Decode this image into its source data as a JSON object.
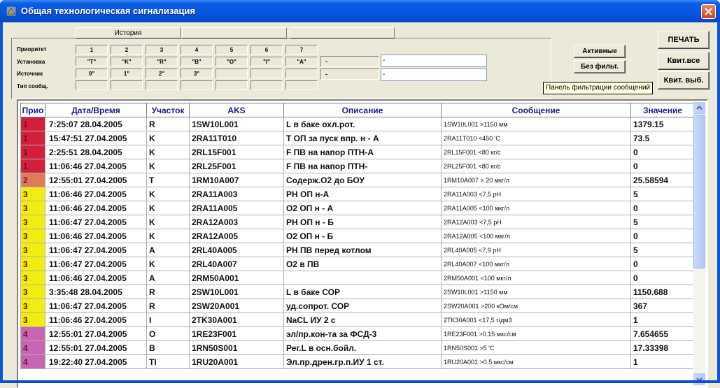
{
  "window": {
    "title": "Общая технологическая сигнализация"
  },
  "header_tabs": [
    "История",
    "",
    ""
  ],
  "filter": {
    "labels": {
      "priority": "Приоритет",
      "setting": "Установка",
      "source": "Источник",
      "msg_type": "Тип сообщ."
    },
    "priority_cols": [
      "1",
      "2",
      "3",
      "4",
      "5",
      "6",
      "7"
    ],
    "setting_vals": [
      "\"T\"",
      "\"K\"",
      "\"R\"",
      "\"B\"",
      "\"O\"",
      "\"I\"",
      "\"A\""
    ],
    "source_vals": [
      "0\"",
      "1\"",
      "2\"",
      "3\"",
      "",
      "",
      ""
    ],
    "dash_1": "-",
    "dash_2": "-",
    "field_1": "-",
    "field_2": "-"
  },
  "buttons": {
    "active": "Активные",
    "no_filter": "Без фильт.",
    "print": "ПЕЧАТЬ",
    "ack_all": "Квит.все",
    "ack_selected": "Квит. выб."
  },
  "tooltip": "Панель фильтрации сообщений",
  "colors": {
    "p1": "#d3203a",
    "p2": "#e07b5a",
    "p3": "#f2ec10",
    "p4": "#c765b5"
  },
  "table": {
    "headers": {
      "prio": "Прио",
      "datetime": "Дата/Время",
      "area": "Участок",
      "aks": "AKS",
      "desc": "Описание",
      "msg": "Сообщение",
      "value": "Значение"
    },
    "rows": [
      {
        "p": "1",
        "dt": "7:25:07   28.04.2005",
        "area": "R",
        "aks": "1SW10L001",
        "desc": "L в баке охл.рот.",
        "msg": "1SW10L001 >1150  мм",
        "val": "1379.15",
        "pc": "p1"
      },
      {
        "p": "1",
        "dt": "15:47:51  27.04.2005",
        "area": "K",
        "aks": "2RA11T010",
        "desc": "T ОП за пуск впр. н - А",
        "msg": "2RA11T010 <450 'C",
        "val": "73.5",
        "pc": "p1"
      },
      {
        "p": "1",
        "dt": "2:25:51   28.04.2005",
        "area": "K",
        "aks": "2RL15F001",
        "desc": "F ПВ на напор ПТН-А",
        "msg": "2RL15F001 <80 кг/с",
        "val": "0",
        "pc": "p1"
      },
      {
        "p": "1",
        "dt": "11:06:46  27.04.2005",
        "area": "K",
        "aks": "2RL25F001",
        "desc": "F ПВ на напор ПТН-",
        "msg": "2RL25F001 <80 кг/с",
        "val": "0",
        "pc": "p1"
      },
      {
        "p": "2",
        "dt": "12:55:01  27.04.2005",
        "area": "T",
        "aks": "1RM10A007",
        "desc": "Содерж.О2 до БОУ",
        "msg": "1RM10A007  > 20  мкг/л",
        "val": "25.58594",
        "pc": "p2"
      },
      {
        "p": "3",
        "dt": "11:06:46  27.04.2005",
        "area": "K",
        "aks": "2RA11A003",
        "desc": "PH ОП н-А",
        "msg": "2RA11A003 <7,5 pH",
        "val": "5",
        "pc": "p3"
      },
      {
        "p": "3",
        "dt": "11:06:46  27.04.2005",
        "area": "K",
        "aks": "2RA11A005",
        "desc": "О2 ОП н - А",
        "msg": "2RA11A005 <100 мкг/л",
        "val": "0",
        "pc": "p3"
      },
      {
        "p": "3",
        "dt": "11:06:47  27.04.2005",
        "area": "K",
        "aks": "2RA12A003",
        "desc": "PH ОП н - Б",
        "msg": "2RA12A003 <7,5  pH",
        "val": "5",
        "pc": "p3"
      },
      {
        "p": "3",
        "dt": "11:06:46  27.04.2005",
        "area": "K",
        "aks": "2RA12A005",
        "desc": "О2 ОП н - Б",
        "msg": "2RA12A005 <100 мкг/л",
        "val": "0",
        "pc": "p3"
      },
      {
        "p": "3",
        "dt": "11:06:47  27.04.2005",
        "area": "A",
        "aks": "2RL40A005",
        "desc": "PH ПВ перед котлом",
        "msg": "2RL40A005 <7,9  pH",
        "val": "5",
        "pc": "p3"
      },
      {
        "p": "3",
        "dt": "11:06:47  27.04.2005",
        "area": "K",
        "aks": "2RL40A007",
        "desc": "О2 в ПВ",
        "msg": "2RL40A007 <100  мкг/л",
        "val": "0",
        "pc": "p3"
      },
      {
        "p": "3",
        "dt": "11:06:46  27.04.2005",
        "area": "A",
        "aks": "2RM50A001",
        "desc": "",
        "msg": "2RM50A001 <100  мкг/л",
        "val": "0",
        "pc": "p3"
      },
      {
        "p": "3",
        "dt": "3:35:48   28.04.2005",
        "area": "R",
        "aks": "2SW10L001",
        "desc": "L в баке СОР",
        "msg": "2SW10L001 >1150 мм",
        "val": "1150.688",
        "pc": "p3"
      },
      {
        "p": "3",
        "dt": "11:06:47  27.04.2005",
        "area": "R",
        "aks": "2SW20A001",
        "desc": "уд.сопрот. СОР",
        "msg": "2SW20A001 >200 кОм/см",
        "val": "367",
        "pc": "p3"
      },
      {
        "p": "3",
        "dt": "11:06:46  27.04.2005",
        "area": "I",
        "aks": "2TK30A001",
        "desc": "NaCL  ИУ 2 с",
        "msg": "2TK30A001 <17,5 г/дм3",
        "val": "1",
        "pc": "p3"
      },
      {
        "p": "4",
        "dt": "12:55:01  27.04.2005",
        "area": "O",
        "aks": "1RE23F001",
        "desc": "эл/пр.кон-та за ФСД-3",
        "msg": "1RE23F001 >0.15 мкс/см",
        "val": "7.654655",
        "pc": "p4"
      },
      {
        "p": "4",
        "dt": "12:55:01  27.04.2005",
        "area": "B",
        "aks": "1RN50S001",
        "desc": "Рег.L в осн.бойл.",
        "msg": "1RN50S001 >5  'C",
        "val": "17.33398",
        "pc": "p4"
      },
      {
        "p": "4",
        "dt": "19:22:40  27.04.2005",
        "area": "TI",
        "aks": "1RU20A001",
        "desc": "Эл.пр.дрен.гр.п.ИУ 1 ст.",
        "msg": "1RU20A001 >0,5 мкс/см",
        "val": "1",
        "pc": "p4"
      }
    ]
  }
}
